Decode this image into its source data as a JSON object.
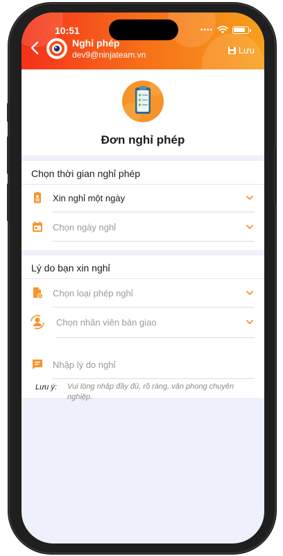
{
  "status_bar": {
    "time": "10:51",
    "battery_level": 0.85
  },
  "header": {
    "back_icon": "chevron-left-icon",
    "title": "Nghỉ phép",
    "subtitle": "dev9@ninjateam.vn",
    "save_label": "Lưu",
    "save_icon": "floppy-disk-icon",
    "gradient": [
      "#f5301a",
      "#f7a01b"
    ]
  },
  "hero": {
    "title": "Đơn nghỉ phép",
    "icon": "clipboard-checklist-icon"
  },
  "section_time": {
    "title": "Chọn thời gian nghỉ phép",
    "rows": [
      {
        "icon": "id-badge-icon",
        "text": "Xin nghỉ một ngày",
        "is_placeholder": false
      },
      {
        "icon": "calendar-icon",
        "text": "Chọn ngày nghỉ",
        "is_placeholder": true
      }
    ]
  },
  "section_reason": {
    "title": "Lý do bạn xin nghỉ",
    "rows": [
      {
        "icon": "document-settings-icon",
        "text": "Chọn loại phép nghỉ",
        "is_placeholder": true
      },
      {
        "icon": "user-handover-icon",
        "text": "Chọn nhân viên bàn giao",
        "is_placeholder": true
      }
    ],
    "reason_input": {
      "icon": "chat-lines-icon",
      "placeholder": "Nhập lý do nghỉ"
    },
    "note_label": "Lưu ý:",
    "note_text": "Vui lòng nhập đầy đủ, rõ ràng, văn phong chuyên nghiệp."
  },
  "colors": {
    "accent": "#f7932a",
    "chevron": "#f7932a",
    "background": "#eef0fb"
  }
}
